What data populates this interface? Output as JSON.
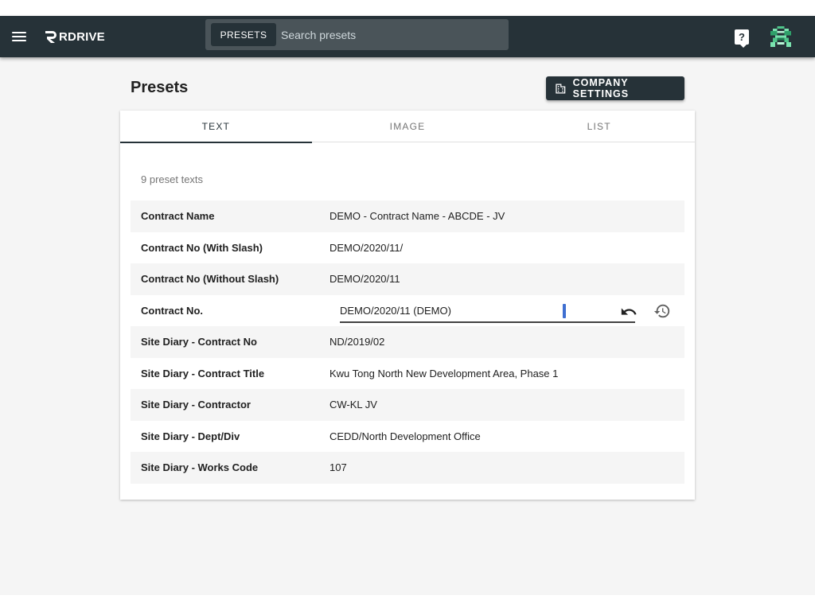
{
  "header": {
    "brand": "RDRIVE",
    "search_chip": "PRESETS",
    "search_placeholder": "Search presets",
    "help_symbol": "?"
  },
  "page": {
    "title": "Presets",
    "company_settings_label": "COMPANY SETTINGS"
  },
  "tabs": [
    {
      "label": "TEXT",
      "active": true
    },
    {
      "label": "IMAGE",
      "active": false
    },
    {
      "label": "LIST",
      "active": false
    }
  ],
  "list": {
    "count_text": "9 preset texts",
    "rows": [
      {
        "name": "Contract Name",
        "value": "DEMO - Contract Name - ABCDE - JV"
      },
      {
        "name": "Contract No (With Slash)",
        "value": "DEMO/2020/11/"
      },
      {
        "name": "Contract No (Without Slash)",
        "value": "DEMO/2020/11"
      },
      {
        "name": "Contract No.",
        "value": "DEMO/2020/11 (DEMO)"
      },
      {
        "name": "Site Diary - Contract No",
        "value": "ND/2019/02"
      },
      {
        "name": "Site Diary - Contract Title",
        "value": "Kwu Tong North New Development Area, Phase 1"
      },
      {
        "name": "Site Diary - Contractor",
        "value": "CW-KL JV"
      },
      {
        "name": "Site Diary - Dept/Div",
        "value": "CEDD/North Development Office"
      },
      {
        "name": "Site Diary - Works Code",
        "value": "107"
      }
    ]
  },
  "colors": {
    "appbar": "#263238",
    "accent": "#263238",
    "avatar": "#7be3b0",
    "cursor": "#3f6fd1"
  },
  "icons": {
    "menu": "menu-icon",
    "help": "help-icon",
    "undo": "undo-icon",
    "restore": "restore-icon",
    "company": "building-icon"
  }
}
